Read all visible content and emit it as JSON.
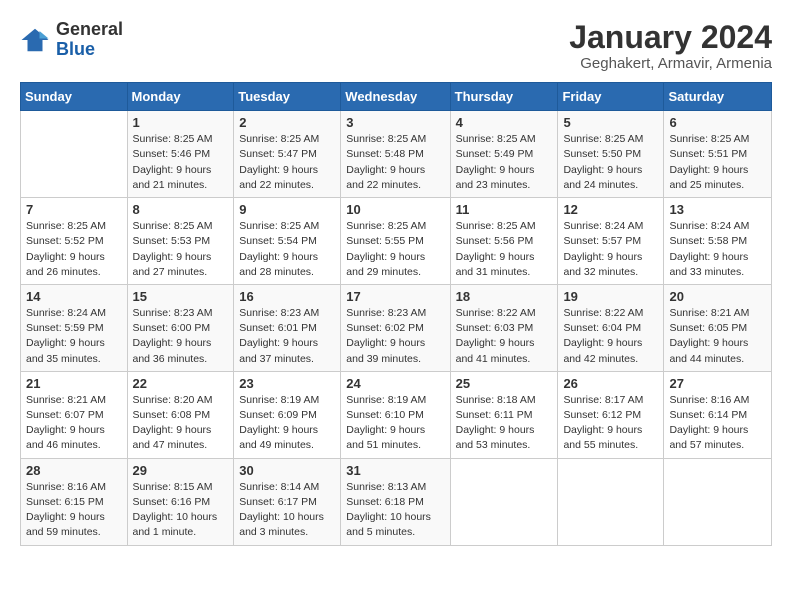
{
  "logo": {
    "general": "General",
    "blue": "Blue"
  },
  "header": {
    "title": "January 2024",
    "subtitle": "Geghakert, Armavir, Armenia"
  },
  "weekdays": [
    "Sunday",
    "Monday",
    "Tuesday",
    "Wednesday",
    "Thursday",
    "Friday",
    "Saturday"
  ],
  "weeks": [
    [
      {
        "day": "",
        "sunrise": "",
        "sunset": "",
        "daylight": ""
      },
      {
        "day": "1",
        "sunrise": "Sunrise: 8:25 AM",
        "sunset": "Sunset: 5:46 PM",
        "daylight": "Daylight: 9 hours and 21 minutes."
      },
      {
        "day": "2",
        "sunrise": "Sunrise: 8:25 AM",
        "sunset": "Sunset: 5:47 PM",
        "daylight": "Daylight: 9 hours and 22 minutes."
      },
      {
        "day": "3",
        "sunrise": "Sunrise: 8:25 AM",
        "sunset": "Sunset: 5:48 PM",
        "daylight": "Daylight: 9 hours and 22 minutes."
      },
      {
        "day": "4",
        "sunrise": "Sunrise: 8:25 AM",
        "sunset": "Sunset: 5:49 PM",
        "daylight": "Daylight: 9 hours and 23 minutes."
      },
      {
        "day": "5",
        "sunrise": "Sunrise: 8:25 AM",
        "sunset": "Sunset: 5:50 PM",
        "daylight": "Daylight: 9 hours and 24 minutes."
      },
      {
        "day": "6",
        "sunrise": "Sunrise: 8:25 AM",
        "sunset": "Sunset: 5:51 PM",
        "daylight": "Daylight: 9 hours and 25 minutes."
      }
    ],
    [
      {
        "day": "7",
        "sunrise": "Sunrise: 8:25 AM",
        "sunset": "Sunset: 5:52 PM",
        "daylight": "Daylight: 9 hours and 26 minutes."
      },
      {
        "day": "8",
        "sunrise": "Sunrise: 8:25 AM",
        "sunset": "Sunset: 5:53 PM",
        "daylight": "Daylight: 9 hours and 27 minutes."
      },
      {
        "day": "9",
        "sunrise": "Sunrise: 8:25 AM",
        "sunset": "Sunset: 5:54 PM",
        "daylight": "Daylight: 9 hours and 28 minutes."
      },
      {
        "day": "10",
        "sunrise": "Sunrise: 8:25 AM",
        "sunset": "Sunset: 5:55 PM",
        "daylight": "Daylight: 9 hours and 29 minutes."
      },
      {
        "day": "11",
        "sunrise": "Sunrise: 8:25 AM",
        "sunset": "Sunset: 5:56 PM",
        "daylight": "Daylight: 9 hours and 31 minutes."
      },
      {
        "day": "12",
        "sunrise": "Sunrise: 8:24 AM",
        "sunset": "Sunset: 5:57 PM",
        "daylight": "Daylight: 9 hours and 32 minutes."
      },
      {
        "day": "13",
        "sunrise": "Sunrise: 8:24 AM",
        "sunset": "Sunset: 5:58 PM",
        "daylight": "Daylight: 9 hours and 33 minutes."
      }
    ],
    [
      {
        "day": "14",
        "sunrise": "Sunrise: 8:24 AM",
        "sunset": "Sunset: 5:59 PM",
        "daylight": "Daylight: 9 hours and 35 minutes."
      },
      {
        "day": "15",
        "sunrise": "Sunrise: 8:23 AM",
        "sunset": "Sunset: 6:00 PM",
        "daylight": "Daylight: 9 hours and 36 minutes."
      },
      {
        "day": "16",
        "sunrise": "Sunrise: 8:23 AM",
        "sunset": "Sunset: 6:01 PM",
        "daylight": "Daylight: 9 hours and 37 minutes."
      },
      {
        "day": "17",
        "sunrise": "Sunrise: 8:23 AM",
        "sunset": "Sunset: 6:02 PM",
        "daylight": "Daylight: 9 hours and 39 minutes."
      },
      {
        "day": "18",
        "sunrise": "Sunrise: 8:22 AM",
        "sunset": "Sunset: 6:03 PM",
        "daylight": "Daylight: 9 hours and 41 minutes."
      },
      {
        "day": "19",
        "sunrise": "Sunrise: 8:22 AM",
        "sunset": "Sunset: 6:04 PM",
        "daylight": "Daylight: 9 hours and 42 minutes."
      },
      {
        "day": "20",
        "sunrise": "Sunrise: 8:21 AM",
        "sunset": "Sunset: 6:05 PM",
        "daylight": "Daylight: 9 hours and 44 minutes."
      }
    ],
    [
      {
        "day": "21",
        "sunrise": "Sunrise: 8:21 AM",
        "sunset": "Sunset: 6:07 PM",
        "daylight": "Daylight: 9 hours and 46 minutes."
      },
      {
        "day": "22",
        "sunrise": "Sunrise: 8:20 AM",
        "sunset": "Sunset: 6:08 PM",
        "daylight": "Daylight: 9 hours and 47 minutes."
      },
      {
        "day": "23",
        "sunrise": "Sunrise: 8:19 AM",
        "sunset": "Sunset: 6:09 PM",
        "daylight": "Daylight: 9 hours and 49 minutes."
      },
      {
        "day": "24",
        "sunrise": "Sunrise: 8:19 AM",
        "sunset": "Sunset: 6:10 PM",
        "daylight": "Daylight: 9 hours and 51 minutes."
      },
      {
        "day": "25",
        "sunrise": "Sunrise: 8:18 AM",
        "sunset": "Sunset: 6:11 PM",
        "daylight": "Daylight: 9 hours and 53 minutes."
      },
      {
        "day": "26",
        "sunrise": "Sunrise: 8:17 AM",
        "sunset": "Sunset: 6:12 PM",
        "daylight": "Daylight: 9 hours and 55 minutes."
      },
      {
        "day": "27",
        "sunrise": "Sunrise: 8:16 AM",
        "sunset": "Sunset: 6:14 PM",
        "daylight": "Daylight: 9 hours and 57 minutes."
      }
    ],
    [
      {
        "day": "28",
        "sunrise": "Sunrise: 8:16 AM",
        "sunset": "Sunset: 6:15 PM",
        "daylight": "Daylight: 9 hours and 59 minutes."
      },
      {
        "day": "29",
        "sunrise": "Sunrise: 8:15 AM",
        "sunset": "Sunset: 6:16 PM",
        "daylight": "Daylight: 10 hours and 1 minute."
      },
      {
        "day": "30",
        "sunrise": "Sunrise: 8:14 AM",
        "sunset": "Sunset: 6:17 PM",
        "daylight": "Daylight: 10 hours and 3 minutes."
      },
      {
        "day": "31",
        "sunrise": "Sunrise: 8:13 AM",
        "sunset": "Sunset: 6:18 PM",
        "daylight": "Daylight: 10 hours and 5 minutes."
      },
      {
        "day": "",
        "sunrise": "",
        "sunset": "",
        "daylight": ""
      },
      {
        "day": "",
        "sunrise": "",
        "sunset": "",
        "daylight": ""
      },
      {
        "day": "",
        "sunrise": "",
        "sunset": "",
        "daylight": ""
      }
    ]
  ]
}
